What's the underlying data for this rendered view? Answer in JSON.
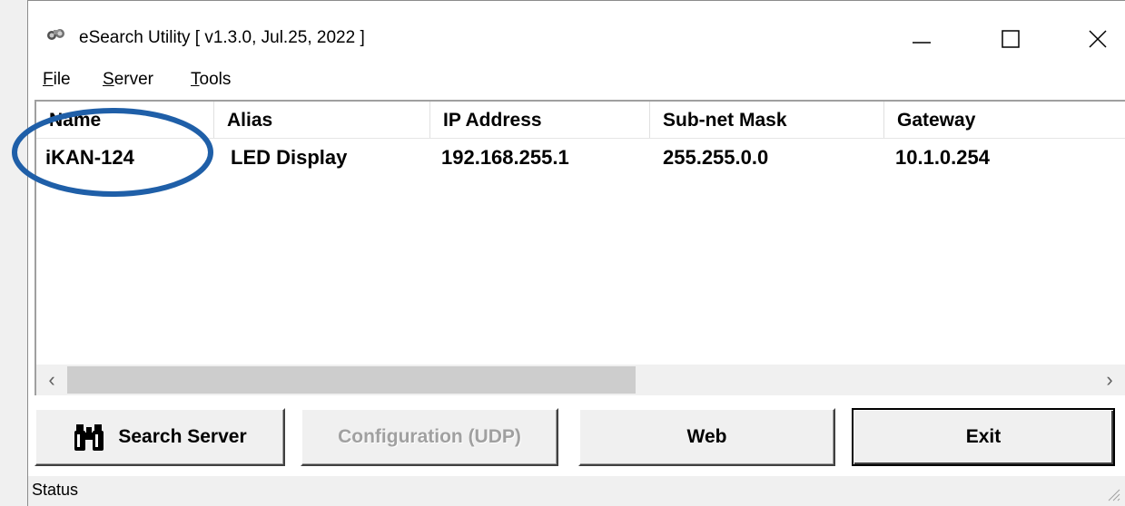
{
  "window": {
    "title": "eSearch Utility [ v1.3.0, Jul.25, 2022 ]",
    "app_icon": "binoculars-icon",
    "controls": {
      "minimize": "minimize-icon",
      "maximize": "maximize-icon",
      "close": "close-icon"
    }
  },
  "menu": {
    "items": [
      {
        "accel": "F",
        "rest": "ile"
      },
      {
        "accel": "S",
        "rest": "erver"
      },
      {
        "accel": "T",
        "rest": "ools"
      }
    ]
  },
  "table": {
    "columns": [
      "Name",
      "Alias",
      "IP Address",
      "Sub-net Mask",
      "Gateway"
    ],
    "rows": [
      {
        "name": "iKAN-124",
        "alias": "LED Display",
        "ip": "192.168.255.1",
        "mask": "255.255.0.0",
        "gateway": "10.1.0.254"
      }
    ]
  },
  "scrollbar": {
    "left_arrow": "‹",
    "right_arrow": "›"
  },
  "buttons": {
    "search": "Search Server",
    "config": "Configuration (UDP)",
    "web": "Web",
    "exit": "Exit"
  },
  "status": {
    "text": "Status"
  },
  "colors": {
    "annotation": "#1f5fa8",
    "disabled_text": "#a0a0a0"
  }
}
